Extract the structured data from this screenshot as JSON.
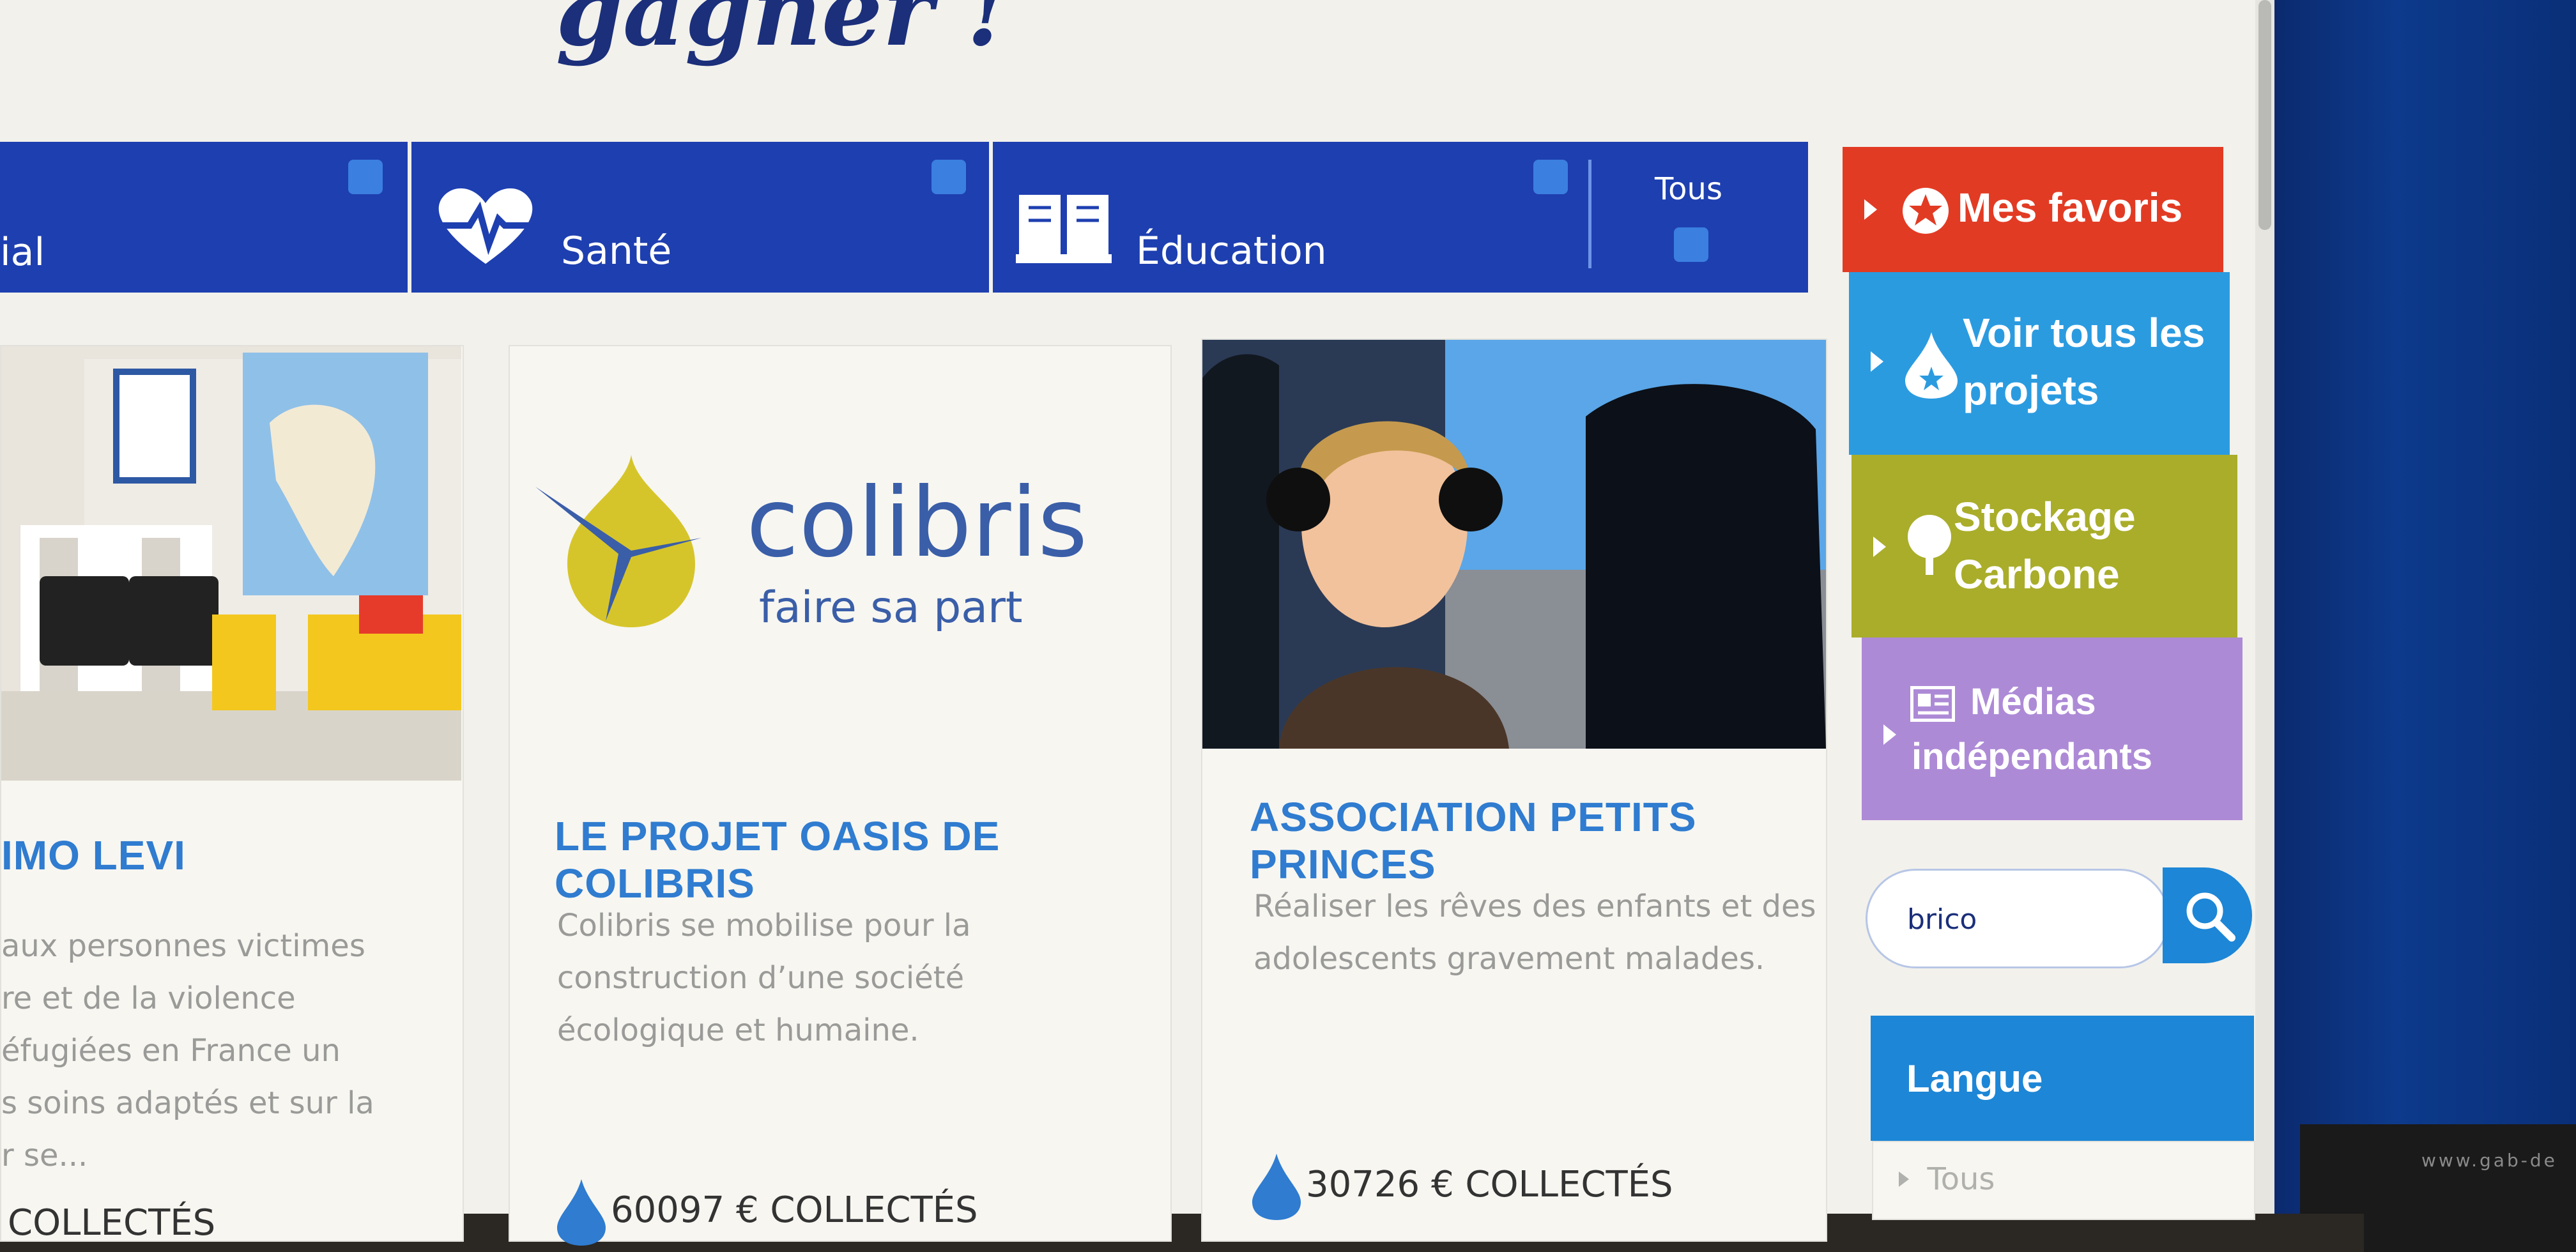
{
  "page": {
    "title": "gagner !"
  },
  "categories": {
    "items": [
      {
        "label": "ial",
        "icon": "category-icon"
      },
      {
        "label": "Santé",
        "icon": "heart-pulse-icon"
      },
      {
        "label": "Éducation",
        "icon": "book-icon"
      }
    ],
    "all_label": "Tous",
    "colors": {
      "bar": "#1e3fb0",
      "checkbox": "#3b7fe0"
    }
  },
  "cards": [
    {
      "title": "IMO LEVI",
      "description": [
        "aux personnes victimes",
        "re et de la violence",
        "éfugiées en France un",
        "s soins adaptés et sur la",
        "r se..."
      ],
      "funds_label": "COLLECTÉS",
      "icon": "drop-icon"
    },
    {
      "logo_name": "colibris",
      "logo_tagline": "faire sa part",
      "title": "LE PROJET OASIS DE COLIBRIS",
      "description": [
        "Colibris se mobilise pour la",
        "construction d’une société",
        "écologique et humaine."
      ],
      "funds_label": "60097 € COLLECTÉS",
      "icon": "drop-icon"
    },
    {
      "title": "ASSOCIATION PETITS PRINCES",
      "description": [
        "Réaliser les rêves des enfants et des",
        "adolescents gravement malades."
      ],
      "funds_label": "30726 € COLLECTÉS",
      "icon": "drop-icon"
    }
  ],
  "sidebar": {
    "menu": [
      {
        "lines": [
          "Mes favoris"
        ],
        "color": "#e23b24",
        "icon": "star-badge-icon"
      },
      {
        "lines": [
          "Voir tous les",
          "projets"
        ],
        "color": "#2b9be0",
        "icon": "drop-star-icon"
      },
      {
        "lines": [
          "Stockage",
          "Carbone"
        ],
        "color": "#a9ad2a",
        "icon": "tree-icon"
      },
      {
        "lines": [
          "Médias",
          "indépendants"
        ],
        "color": "#ad8ad6",
        "icon": "newspaper-icon"
      }
    ],
    "search": {
      "value": "brico",
      "icon": "search-icon"
    },
    "language": {
      "heading": "Langue",
      "option": "Tous"
    }
  },
  "bezel_text": "www.gab-de"
}
